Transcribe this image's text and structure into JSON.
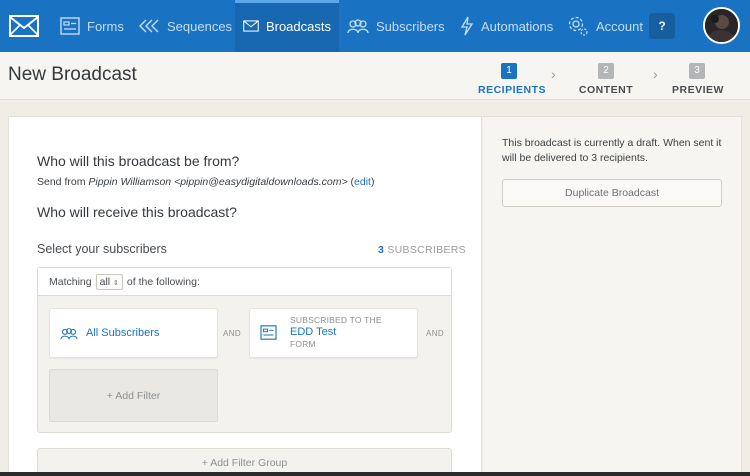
{
  "nav": {
    "items": [
      {
        "label": "Forms",
        "icon": "form-icon"
      },
      {
        "label": "Sequences",
        "icon": "sequences-icon"
      },
      {
        "label": "Broadcasts",
        "icon": "broadcast-envelope-icon",
        "active": true
      },
      {
        "label": "Subscribers",
        "icon": "subscribers-icon"
      },
      {
        "label": "Automations",
        "icon": "lightning-icon"
      },
      {
        "label": "Account",
        "icon": "gear-icon"
      }
    ],
    "help_label": "?"
  },
  "header": {
    "title": "New Broadcast",
    "steps": [
      {
        "number": "1",
        "label": "RECIPIENTS",
        "active": true
      },
      {
        "number": "2",
        "label": "CONTENT"
      },
      {
        "number": "3",
        "label": "PREVIEW"
      }
    ],
    "separator": "›"
  },
  "main": {
    "from_heading": "Who will this broadcast be from?",
    "send_from_prefix": "Send from",
    "sender_name": "Pippin Williamson",
    "sender_email": "<pippin@easydigitaldownloads.com>",
    "edit_open": "(",
    "edit_label": "edit",
    "edit_close": ")",
    "receive_heading": "Who will receive this broadcast?",
    "select_label": "Select your subscribers",
    "subscriber_count": "3",
    "subscriber_count_label": "SUBSCRIBERS",
    "matching_prefix": "Matching",
    "matching_value": "all",
    "matching_suffix": "of the following:",
    "filter_all_label": "All Subscribers",
    "and_label": "AND",
    "filter_form_prefix": "SUBSCRIBED TO THE",
    "filter_form_name": "EDD Test",
    "filter_form_suffix": "FORM",
    "add_filter_label": "+ Add Filter",
    "add_filter_group_label": "+ Add Filter Group"
  },
  "side": {
    "draft_note": "This broadcast is currently a draft. When sent it will be delivered to 3 recipients.",
    "duplicate_label": "Duplicate Broadcast"
  },
  "colors": {
    "nav_bg": "#1a73c2",
    "accent": "#1a73c2",
    "page_bg": "#efede6"
  }
}
